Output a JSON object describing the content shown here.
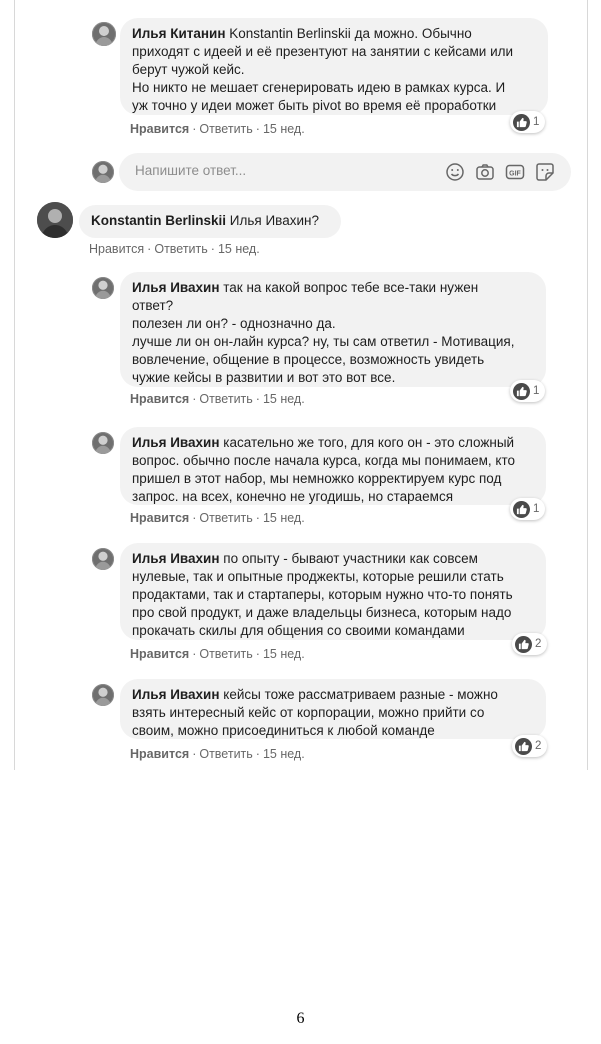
{
  "comments": [
    {
      "author": "Илья Китанин",
      "mention": "Konstantin Berlinskii",
      "text_lines": [
        "да можно. Обычно",
        "приходят с идеей и её презентуют на занятии с кейсами или",
        "берут чужой кейс.",
        "Но никто не мешает сгенерировать идею в рамках курса. И",
        "уж точно у идеи может быть pivot во время её проработки"
      ],
      "like_label": "Нравится",
      "reply_label": "Ответить",
      "time": "15 нед.",
      "reactions": "1"
    },
    {
      "author": "Konstantin Berlinskii",
      "mention": "Илья Ивахин?",
      "text_lines": [],
      "like_label": "Нравится",
      "reply_label": "Ответить",
      "time": "15 нед."
    },
    {
      "author": "Илья Ивахин",
      "text_lines": [
        "так на какой вопрос тебе все-таки нужен",
        "ответ?",
        "полезен ли он? - однозначно да.",
        "лучше ли он он-лайн курса? ну, ты сам ответил - Мотивация,",
        "вовлечение, общение в процессе, возможность увидеть",
        "чужие кейсы в развитии и вот это вот все."
      ],
      "like_label": "Нравится",
      "reply_label": "Ответить",
      "time": "15 нед.",
      "reactions": "1"
    },
    {
      "author": "Илья Ивахин",
      "text_lines": [
        "касательно же того, для кого он - это сложный",
        "вопрос. обычно после начала курса, когда мы понимаем, кто",
        "пришел в этот набор, мы немножко корректируем курс под",
        "запрос. на всех, конечно не угодишь, но стараемся"
      ],
      "like_label": "Нравится",
      "reply_label": "Ответить",
      "time": "15 нед.",
      "reactions": "1"
    },
    {
      "author": "Илья Ивахин",
      "text_lines": [
        "по опыту - бывают участники как совсем",
        "нулевые, так и опытные проджекты, которые решили стать",
        "продактами, так и стартаперы, которым нужно что-то понять",
        "про свой продукт, и даже владельцы бизнеса, которым надо",
        "прокачать скилы для общения со своими командами"
      ],
      "like_label": "Нравится",
      "reply_label": "Ответить",
      "time": "15 нед.",
      "reactions": "2"
    },
    {
      "author": "Илья Ивахин",
      "text_lines": [
        "кейсы тоже рассматриваем разные - можно",
        "взять интересный кейс от корпорации, можно прийти со",
        "своим, можно присоединиться к любой команде"
      ],
      "like_label": "Нравится",
      "reply_label": "Ответить",
      "time": "15 нед.",
      "reactions": "2"
    }
  ],
  "reply_box": {
    "placeholder": "Напишите ответ..."
  },
  "icons": [
    "emoji-icon",
    "camera-icon",
    "gif-icon",
    "sticker-icon",
    "like-thumb-icon"
  ],
  "page_number": "6"
}
